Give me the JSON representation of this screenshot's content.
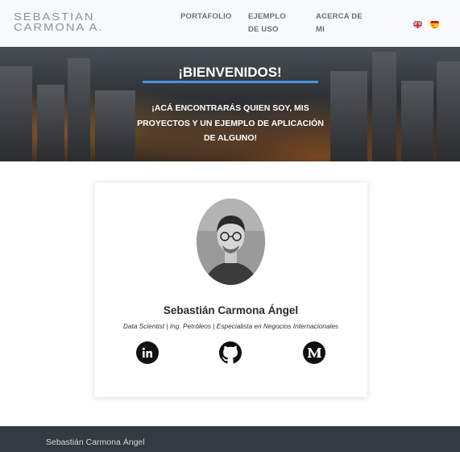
{
  "brand": {
    "logo_line1": "SEBASTIAN",
    "logo_line2": "CARMONA A."
  },
  "nav": {
    "items": [
      {
        "label": "PORTAFOLIO"
      },
      {
        "label": "EJEMPLO DE USO"
      },
      {
        "label": "ACERCA DE MI"
      }
    ],
    "languages": [
      {
        "icon": "uk-flag-icon"
      },
      {
        "icon": "spain-flag-icon"
      }
    ]
  },
  "hero": {
    "title": "¡BIENVENIDOS!",
    "subtitle": "¡ACÁ ENCONTRARÁS QUIEN SOY, MIS PROYECTOS Y UN EJEMPLO DE APLICACIÓN DE ALGUNO!",
    "accent_color": "#4a90e2"
  },
  "profile": {
    "name": "Sebastián Carmona Ángel",
    "tagline": "Data Scientist | Ing. Petróleos | Especialista en Negocios Internacionales",
    "socials": [
      {
        "icon": "linkedin-icon"
      },
      {
        "icon": "github-icon"
      },
      {
        "icon": "medium-icon"
      }
    ]
  },
  "footer": {
    "text": "Sebastián Carmona Ángel"
  }
}
